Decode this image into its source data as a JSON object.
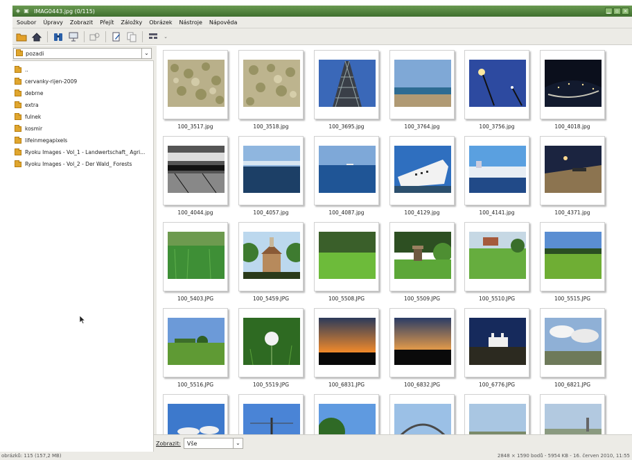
{
  "window": {
    "title": "IMAG0443.jpg  (0/115)"
  },
  "menu": [
    "Soubor",
    "Úpravy",
    "Zobrazit",
    "Přejít",
    "Záložky",
    "Obrázek",
    "Nástroje",
    "Nápověda"
  ],
  "toolbar": {
    "icons": [
      "open-folder-icon",
      "home-icon",
      "binoculars-icon",
      "slideshow-icon",
      "zoom-icon",
      "edit-icon",
      "copy-icon",
      "view-options-icon",
      "dropdown-arrow-icon"
    ]
  },
  "sidebar": {
    "current_folder": "pozadi",
    "folders": [
      "..",
      "cervanky-rijen-2009",
      "debrne",
      "extra",
      "fulnek",
      "kosmir",
      "lifeinmegapixels",
      "Ryoku Images - Vol_1 - Landwertschaft_ Agri...",
      "Ryoku Images - Vol_2 - Der Wald_ Forests"
    ]
  },
  "gallery": {
    "thumbnails": [
      "100_3517.jpg",
      "100_3518.jpg",
      "100_3695.jpg",
      "100_3764.jpg",
      "100_3756.jpg",
      "100_4018.jpg",
      "100_4044.jpg",
      "100_4057.jpg",
      "100_4087.jpg",
      "100_4129.jpg",
      "100_4141.jpg",
      "100_4371.jpg",
      "100_5403.JPG",
      "100_5459.JPG",
      "100_5508.JPG",
      "100_5509.JPG",
      "100_5510.JPG",
      "100_5515.JPG",
      "100_5516.JPG",
      "100_5519.JPG",
      "100_6831.JPG",
      "100_6832.JPG",
      "100_6776.JPG",
      "100_6821.JPG",
      "",
      "",
      "",
      "",
      "",
      ""
    ]
  },
  "filter": {
    "label": "Zobrazit:",
    "value": "Vše"
  },
  "status": {
    "left": "obrázků: 115 (157,2 MB)",
    "right": "2848 × 1590 bodů - 5954 KB - 16. červen 2010, 11:55"
  }
}
